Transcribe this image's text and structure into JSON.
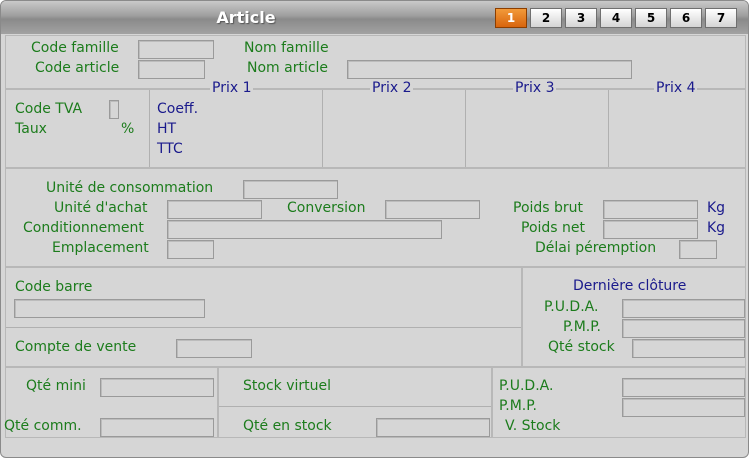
{
  "window": {
    "title": "Article"
  },
  "tabs": [
    "1",
    "2",
    "3",
    "4",
    "5",
    "6",
    "7"
  ],
  "active_tab": "1",
  "header": {
    "code_famille": "Code famille",
    "nom_famille": "Nom famille",
    "code_article": "Code article",
    "nom_article": "Nom article"
  },
  "prices": {
    "code_tva": "Code TVA",
    "taux": "Taux",
    "percent": "%",
    "columns": [
      "Prix 1",
      "Prix 2",
      "Prix 3",
      "Prix 4"
    ],
    "rows": [
      "Coeff.",
      "HT",
      "TTC"
    ]
  },
  "units": {
    "unite_consommation": "Unité de consommation",
    "unite_achat": "Unité d'achat",
    "conversion": "Conversion",
    "conditionnement": "Conditionnement",
    "emplacement": "Emplacement",
    "poids_brut": "Poids brut",
    "poids_net": "Poids net",
    "kg": "Kg",
    "delai_peremption": "Délai péremption"
  },
  "codes": {
    "code_barre": "Code barre",
    "compte_vente": "Compte de vente"
  },
  "cloture": {
    "title": "Dernière clôture",
    "puda": "P.U.D.A.",
    "pmp": "P.M.P.",
    "qte_stock": "Qté stock"
  },
  "stock": {
    "qte_mini": "Qté mini",
    "qte_comm": "Qté comm.",
    "stock_virtuel": "Stock virtuel",
    "qte_en_stock": "Qté en stock",
    "puda": "P.U.D.A.",
    "pmp": "P.M.P.",
    "v_stock": "V. Stock"
  }
}
